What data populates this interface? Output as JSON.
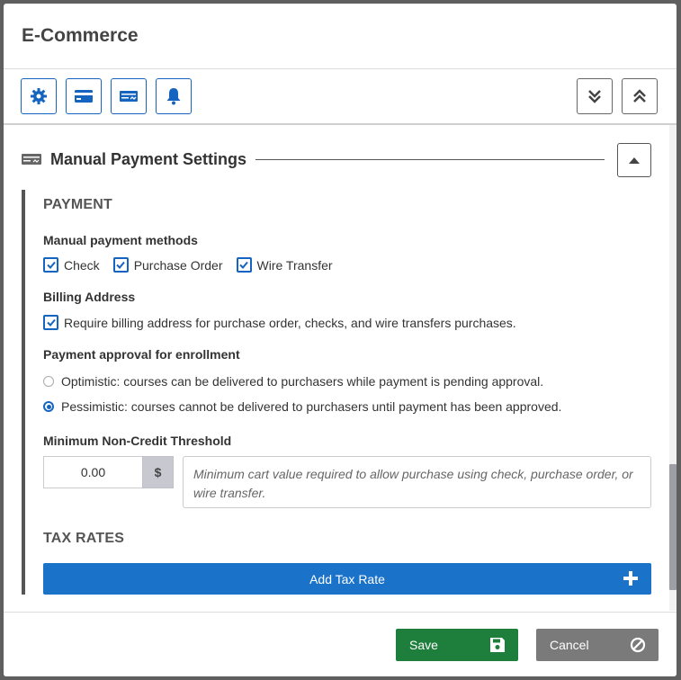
{
  "modal": {
    "title": "E-Commerce"
  },
  "toolbar": {
    "left_icons": [
      "gear-icon",
      "credit-card-icon",
      "check-payment-icon",
      "bell-icon"
    ],
    "right_icons": [
      "expand-all-icon",
      "collapse-all-icon"
    ]
  },
  "section": {
    "title": "Manual Payment Settings",
    "icon": "check-payment-icon"
  },
  "payment": {
    "heading": "PAYMENT",
    "methods_label": "Manual payment methods",
    "methods": [
      {
        "label": "Check",
        "checked": true
      },
      {
        "label": "Purchase Order",
        "checked": true
      },
      {
        "label": "Wire Transfer",
        "checked": true
      }
    ],
    "billing_label": "Billing Address",
    "billing_option": {
      "label": "Require billing address for purchase order, checks, and wire transfers purchases.",
      "checked": true
    },
    "approval_label": "Payment approval for enrollment",
    "approval_options": [
      {
        "label": "Optimistic: courses can be delivered to purchasers while payment is pending approval.",
        "selected": false
      },
      {
        "label": "Pessimistic: courses cannot be delivered to purchasers until payment has been approved.",
        "selected": true
      }
    ],
    "threshold_label": "Minimum Non-Credit Threshold",
    "threshold_value": "0.00",
    "threshold_addon": "$",
    "threshold_hint": "Minimum cart value required to allow purchase using check, purchase order, or wire transfer."
  },
  "tax": {
    "heading": "TAX RATES",
    "add_label": "Add Tax Rate"
  },
  "footer": {
    "save_label": "Save",
    "cancel_label": "Cancel"
  },
  "colors": {
    "primary": "#1a73c8",
    "save": "#1e7e3c",
    "cancel": "#7a7a7a"
  }
}
